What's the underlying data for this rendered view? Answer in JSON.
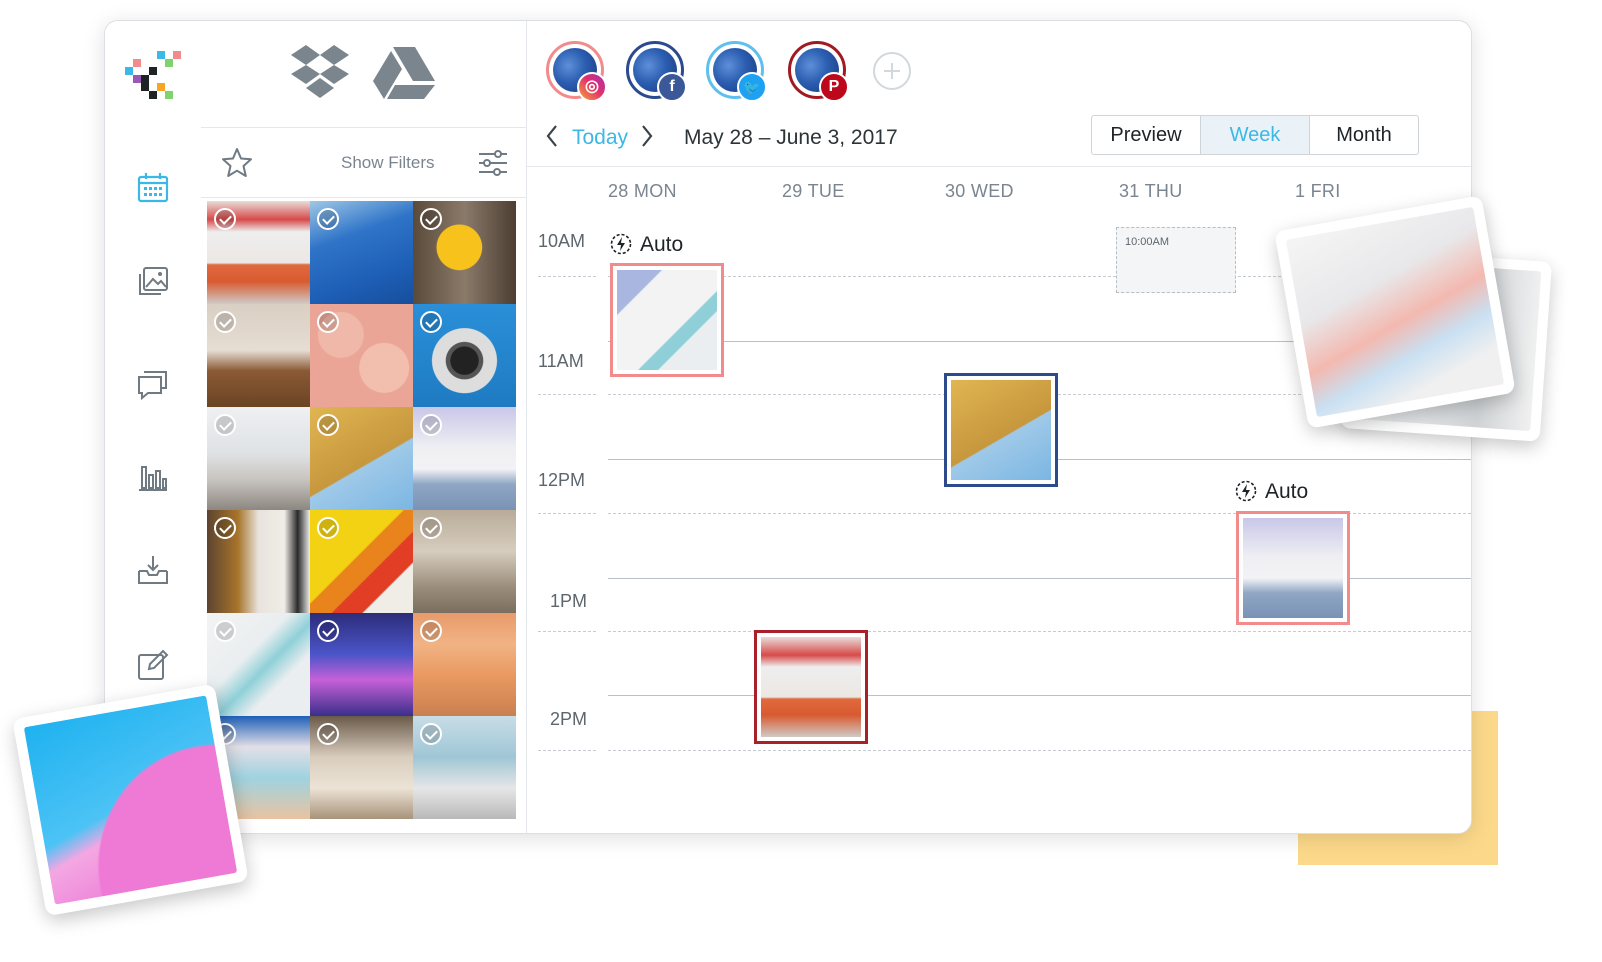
{
  "library": {
    "show_filters_label": "Show Filters",
    "cloud_sources": [
      "dropbox-icon",
      "google-drive-icon"
    ]
  },
  "sidebar": {
    "icons": [
      "calendar-icon",
      "media-library-icon",
      "conversations-icon",
      "analytics-icon",
      "inbox-icon",
      "edit-icon"
    ]
  },
  "profiles": [
    {
      "network": "instagram",
      "badge_color": "#e1306c",
      "ring_color": "#f28b8b"
    },
    {
      "network": "facebook",
      "badge_color": "#3b5998",
      "ring_color": "#2b4a8f"
    },
    {
      "network": "twitter",
      "badge_color": "#1da1f2",
      "ring_color": "#5fc0ee"
    },
    {
      "network": "pinterest",
      "badge_color": "#bd081c",
      "ring_color": "#a11a22"
    }
  ],
  "nav": {
    "today_label": "Today",
    "date_range": "May 28 – June 3, 2017",
    "views": [
      "Preview",
      "Week",
      "Month"
    ],
    "active_view": "Week"
  },
  "calendar": {
    "days": [
      "28 MON",
      "29 TUE",
      "30 WED",
      "31 THU",
      "1 FRI"
    ],
    "times": [
      "10AM",
      "11AM",
      "12PM",
      "1PM",
      "2PM"
    ],
    "auto_label": "Auto",
    "placeholder_time": "10:00AM"
  },
  "colors": {
    "accent": "#3bb8e6",
    "instagram_border": "#f28b8b",
    "facebook_border": "#2d4a8a",
    "pinterest_border": "#a8202a",
    "highlight_yellow": "#fcd98a"
  }
}
